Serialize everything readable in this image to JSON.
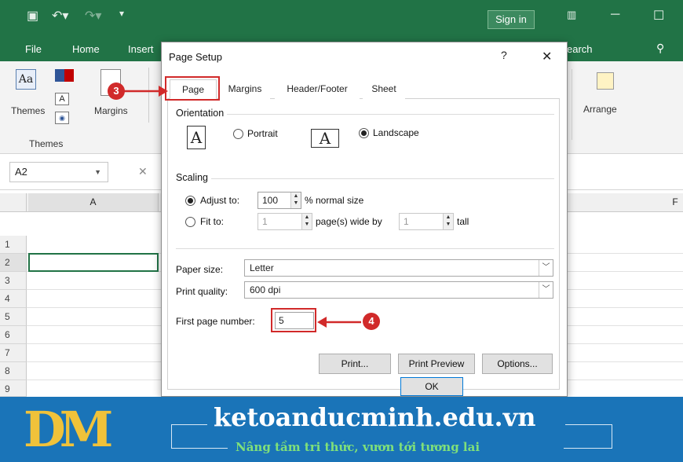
{
  "excel": {
    "signin": "Sign in",
    "tabs": [
      "File",
      "Home",
      "Insert",
      "earch"
    ],
    "ribbon": {
      "themes_label": "Themes",
      "themes_group": "Themes",
      "margins_label": "Margins",
      "arrange_label": "Arrange"
    },
    "namebox": "A2",
    "columns": {
      "a": "A",
      "f": "F"
    },
    "rows": [
      "1",
      "2",
      "3",
      "4",
      "5",
      "6",
      "7",
      "8",
      "9"
    ]
  },
  "dialog": {
    "title": "Page Setup",
    "help": "?",
    "close": "✕",
    "tabs": [
      "Page",
      "Margins",
      "Header/Footer",
      "Sheet"
    ],
    "orientation": {
      "label": "Orientation",
      "portrait": "Portrait",
      "landscape": "Landscape",
      "selected": "landscape",
      "icon_letter": "A"
    },
    "scaling": {
      "label": "Scaling",
      "adjust_to": "Adjust to:",
      "adjust_value": "100",
      "normal_size": "% normal size",
      "fit_to": "Fit to:",
      "fit_wide_value": "1",
      "pages_wide_by": "page(s) wide by",
      "fit_tall_value": "1",
      "tall": "tall"
    },
    "paper_size_label": "Paper size:",
    "paper_size_value": "Letter",
    "print_quality_label": "Print quality:",
    "print_quality_value": "600 dpi",
    "first_page_label": "First page number:",
    "first_page_value": "5",
    "buttons": {
      "print": "Print...",
      "print_preview": "Print Preview",
      "options": "Options...",
      "ok": "OK"
    }
  },
  "annotations": {
    "step3": "3",
    "step4": "4"
  },
  "banner": {
    "logo": "DM",
    "site": "ketoanducminh.edu.vn",
    "slogan": "Nâng tầm tri thức, vươn tới tương lai"
  },
  "colors": {
    "excel_green": "#217346",
    "annotation_red": "#d12a2a",
    "banner_blue": "#1a74b8"
  }
}
